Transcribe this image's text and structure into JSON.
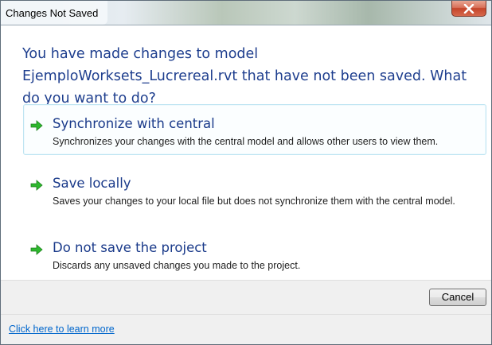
{
  "window": {
    "title": "Changes Not Saved",
    "close_icon": "close-x-icon"
  },
  "main": {
    "instruction": "You have made changes to model EjemploWorksets_Lucrereal.rvt that have not been saved.  What do you want to do?",
    "commands": [
      {
        "icon": "green-arrow-icon",
        "title": "Synchronize with central",
        "description": "Synchronizes your changes with the central model and allows other users to view them.",
        "selected": true
      },
      {
        "icon": "green-arrow-icon",
        "title": "Save locally",
        "description": "Saves your changes to your local file but does not synchronize them with the central model."
      },
      {
        "icon": "green-arrow-icon",
        "title": "Do not save the project",
        "description": "Discards any unsaved changes you made to the project."
      }
    ]
  },
  "buttons": {
    "cancel_label": "Cancel"
  },
  "footer": {
    "link_text": "Click here to learn more"
  },
  "colors": {
    "instruction_text": "#1e3e8e",
    "command_title": "#1a3a8a",
    "arrow_green": "#2db82d",
    "link": "#0066cc",
    "selected_border": "#bfe5f2"
  }
}
